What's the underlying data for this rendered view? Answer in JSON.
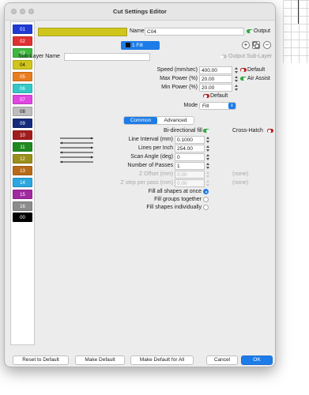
{
  "window": {
    "title": "Cut Settings Editor"
  },
  "layers": [
    {
      "label": "01",
      "color": "#1f3bd6",
      "text_color": "#ffffff"
    },
    {
      "label": "02",
      "color": "#e03131",
      "text_color": "#ffffff"
    },
    {
      "label": "03",
      "color": "#3fb83f",
      "text_color": "#ffffff"
    },
    {
      "label": "04",
      "color": "#cfc51b",
      "text_color": "#111111"
    },
    {
      "label": "05",
      "color": "#e87d1f",
      "text_color": "#ffffff"
    },
    {
      "label": "06",
      "color": "#36c8c8",
      "text_color": "#ffffff"
    },
    {
      "label": "07",
      "color": "#e046e0",
      "text_color": "#ffffff"
    },
    {
      "label": "08",
      "color": "#bdbdbd",
      "text_color": "#111111"
    },
    {
      "label": "09",
      "color": "#142a7a",
      "text_color": "#ffffff"
    },
    {
      "label": "10",
      "color": "#a11d1d",
      "text_color": "#ffffff"
    },
    {
      "label": "11",
      "color": "#1f8a1f",
      "text_color": "#ffffff"
    },
    {
      "label": "12",
      "color": "#9a8f1b",
      "text_color": "#ffffff"
    },
    {
      "label": "13",
      "color": "#b86a1a",
      "text_color": "#ffffff"
    },
    {
      "label": "14",
      "color": "#2ba6e0",
      "text_color": "#ffffff"
    },
    {
      "label": "15",
      "color": "#a02aa0",
      "text_color": "#ffffff"
    },
    {
      "label": "16",
      "color": "#8c8c8c",
      "text_color": "#ffffff"
    },
    {
      "label": "00",
      "color": "#000000",
      "text_color": "#ffffff"
    }
  ],
  "header": {
    "name_label": "Name",
    "name_value": "C04",
    "output_label": "Output",
    "fill_tab": "1 Fill",
    "sublayer_name_label": "Sub-Layer Name",
    "sublayer_name_value": "",
    "output_sublayer_label": "Output Sub-Layer"
  },
  "power": {
    "speed_label": "Speed (mm/sec)",
    "speed_value": "400.00",
    "default_label": "Default",
    "max_power_label": "Max Power (%)",
    "max_power_value": "20.00",
    "air_assist_label": "Air Assist",
    "min_power_label": "Min Power (%)",
    "min_power_value": "20.00",
    "default2_label": "Default",
    "mode_label": "Mode",
    "mode_value": "Fill"
  },
  "tabs": {
    "common": "Common",
    "advanced": "Advanced"
  },
  "fill": {
    "bidirectional_label": "Bi-directional fill",
    "crosshatch_label": "Cross-Hatch",
    "line_interval_label": "Line Interval (mm)",
    "line_interval_value": "0.1000",
    "lpi_label": "Lines per Inch",
    "lpi_value": "254.00",
    "scan_angle_label": "Scan Angle (deg)",
    "scan_angle_value": "0",
    "passes_label": "Number of Passes",
    "passes_value": "1",
    "z_offset_label": "Z Offset (mm)",
    "z_offset_value": "0.00",
    "z_offset_none": "(none)",
    "z_step_label": "Z step per pass (mm)",
    "z_step_value": "0.00",
    "z_step_none": "(none)"
  },
  "fill_options": {
    "all_at_once": "Fill all shapes at once",
    "groups_together": "Fill groups together",
    "individually": "Fill shapes individually",
    "selected": "all_at_once"
  },
  "footer": {
    "reset": "Reset to Default",
    "make_default": "Make Default",
    "make_default_all": "Make Default for All",
    "cancel": "Cancel",
    "ok": "OK"
  }
}
